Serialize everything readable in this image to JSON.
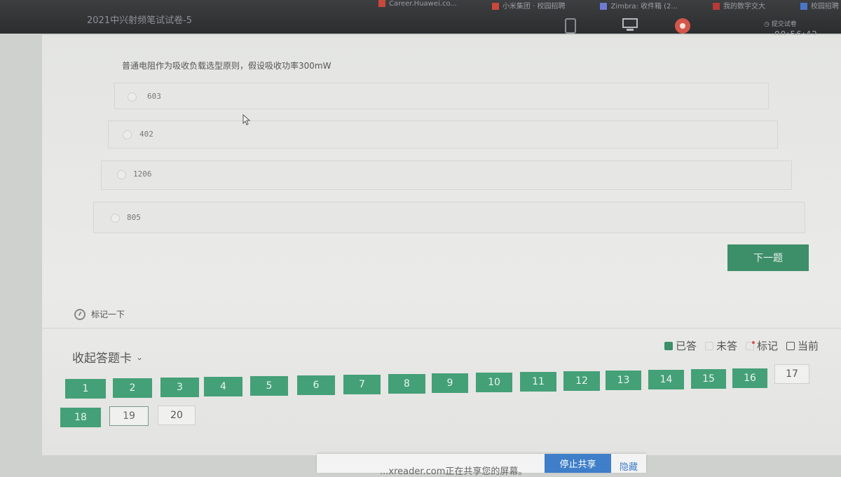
{
  "topbar": {
    "bookmarks": [
      "Career.Huawei.co...",
      "小米集团 · 校园招聘",
      "Zimbra: 收件箱 (2...",
      "我的数字交大",
      "校园招聘"
    ],
    "exam_title": "2021中兴射频笔试试卷-5",
    "submit_label": "提交试卷",
    "timer": "00:56:42"
  },
  "question": {
    "text": "普通电阻作为吸收负载选型原则，假设吸收功率300mW",
    "options": [
      "603",
      "402",
      "1206",
      "805"
    ]
  },
  "next_button": "下一题",
  "mark_label": "标记一下",
  "answer_card": {
    "collapse_label": "收起答题卡",
    "legend": {
      "answered": "已答",
      "unanswered": "未答",
      "marked": "标记",
      "current": "当前"
    },
    "questions": [
      {
        "n": "1",
        "state": "done"
      },
      {
        "n": "2",
        "state": "done"
      },
      {
        "n": "3",
        "state": "done"
      },
      {
        "n": "4",
        "state": "done"
      },
      {
        "n": "5",
        "state": "done"
      },
      {
        "n": "6",
        "state": "done"
      },
      {
        "n": "7",
        "state": "done"
      },
      {
        "n": "8",
        "state": "done"
      },
      {
        "n": "9",
        "state": "done"
      },
      {
        "n": "10",
        "state": "done"
      },
      {
        "n": "11",
        "state": "done"
      },
      {
        "n": "12",
        "state": "done"
      },
      {
        "n": "13",
        "state": "done"
      },
      {
        "n": "14",
        "state": "done"
      },
      {
        "n": "15",
        "state": "done"
      },
      {
        "n": "16",
        "state": "done"
      },
      {
        "n": "17",
        "state": "todo"
      },
      {
        "n": "18",
        "state": "done"
      },
      {
        "n": "19",
        "state": "current"
      },
      {
        "n": "20",
        "state": "todo"
      }
    ]
  },
  "sharebar": {
    "message": "...xreader.com正在共享您的屏幕。",
    "stop_label": "停止共享",
    "hide_label": "隐藏"
  },
  "colors": {
    "accent": "#44a077",
    "button": "#3d8f69",
    "share_blue": "#3f7ec9"
  }
}
